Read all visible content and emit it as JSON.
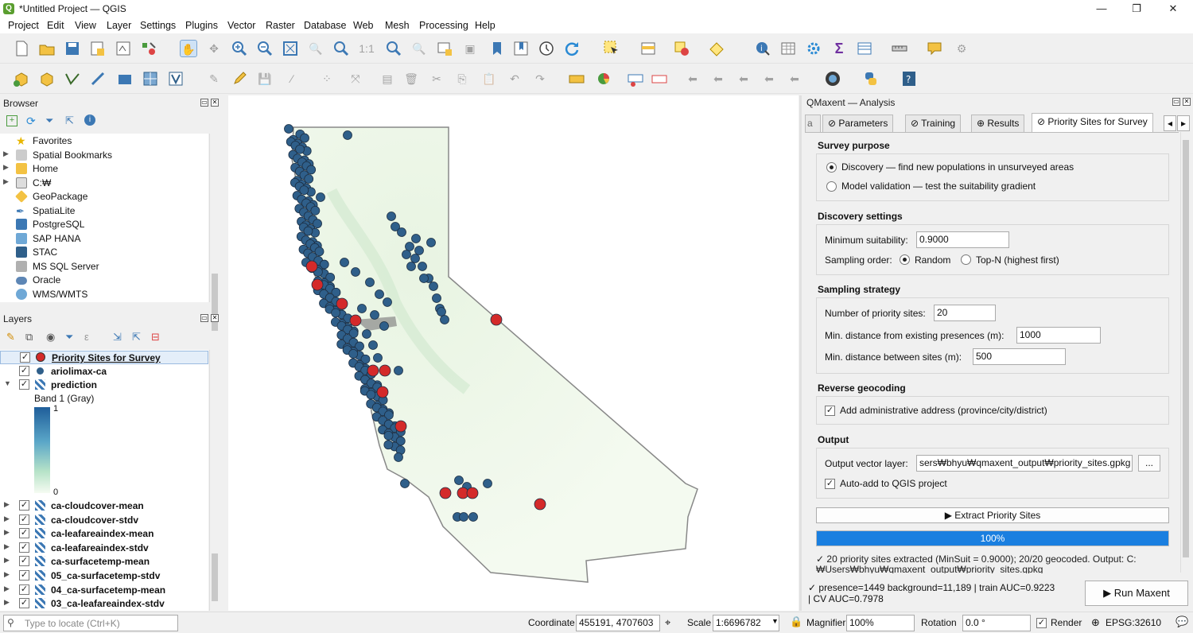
{
  "window": {
    "title": "*Untitled Project — QGIS",
    "min": "—",
    "max": "❐",
    "close": "✕"
  },
  "menu": [
    "Project",
    "Edit",
    "View",
    "Layer",
    "Settings",
    "Plugins",
    "Vector",
    "Raster",
    "Database",
    "Web",
    "Mesh",
    "Processing",
    "Help"
  ],
  "browser": {
    "title": "Browser",
    "items": [
      "Favorites",
      "Spatial Bookmarks",
      "Home",
      "C:₩",
      "GeoPackage",
      "SpatiaLite",
      "PostgreSQL",
      "SAP HANA",
      "STAC",
      "MS SQL Server",
      "Oracle",
      "WMS/WMTS"
    ]
  },
  "layers": {
    "title": "Layers",
    "items": [
      "Priority Sites for Survey",
      "ariolimax-ca",
      "prediction",
      "ca-cloudcover-mean",
      "ca-cloudcover-stdv",
      "ca-leafareaindex-mean",
      "ca-leafareaindex-stdv",
      "ca-surfacetemp-mean",
      "05_ca-surfacetemp-stdv",
      "04_ca-surfacetemp-mean",
      "03_ca-leafareaindex-stdv"
    ],
    "band": "Band 1 (Gray)",
    "legend_max": "1",
    "legend_min": "0"
  },
  "panel": {
    "title": "QMaxent — Analysis",
    "tabs": [
      "a",
      "⊘ Parameters",
      "⊘ Training",
      "⊕ Results",
      "⊘ Priority Sites for Survey"
    ],
    "survey": {
      "heading": "Survey purpose",
      "opt1": "Discovery — find new populations in unsurveyed areas",
      "opt2": "Model validation — test the suitability gradient"
    },
    "discovery": {
      "heading": "Discovery settings",
      "min_label": "Minimum suitability:",
      "min_value": "0.9000",
      "order_label": "Sampling order:",
      "order_random": "Random",
      "order_topn": "Top-N (highest first)"
    },
    "sampling": {
      "heading": "Sampling strategy",
      "n_label": "Number of priority sites:",
      "n_value": "20",
      "dist_pres_label": "Min. distance from existing presences (m):",
      "dist_pres_value": "1000",
      "dist_sites_label": "Min. distance between sites (m):",
      "dist_sites_value": "500"
    },
    "geocoding": {
      "heading": "Reverse geocoding",
      "check_label": "Add administrative address (province/city/district)"
    },
    "output": {
      "heading": "Output",
      "vector_label": "Output vector layer:",
      "vector_value": "sers₩bhyu₩qmaxent_output₩priority_sites.gpkg",
      "browse": "...",
      "autoadd_label": "Auto-add to QGIS project"
    },
    "extract_button": "▶  Extract Priority Sites",
    "progress_text": "100%",
    "progress_value": 1.0,
    "log_line1": "✓ 20 priority sites extracted (MinSuit = 0.9000); 20/20 geocoded. Output: C:",
    "log_line2": "₩Users₩bhyu₩qmaxent_output₩priority_sites.gpkg",
    "summary_line1": "✓ presence=1449  background=11,189  |  train AUC=0.9223",
    "summary_line2": "|  CV AUC=0.7978",
    "run_button": "▶  Run Maxent"
  },
  "status": {
    "locate_placeholder": "Type to locate (Ctrl+K)",
    "coord_label": "Coordinate",
    "coord_value": "455191, 4707603",
    "scale_label": "Scale",
    "scale_value": "1:6696782",
    "magnifier_label": "Magnifier",
    "magnifier_value": "100%",
    "rotation_label": "Rotation",
    "rotation_value": "0.0 °",
    "render_label": "Render",
    "crs": "EPSG:32610"
  },
  "colors": {
    "presence": "#2f5f8a",
    "priority": "#d42a2a",
    "accent": "#1a7fe0"
  }
}
